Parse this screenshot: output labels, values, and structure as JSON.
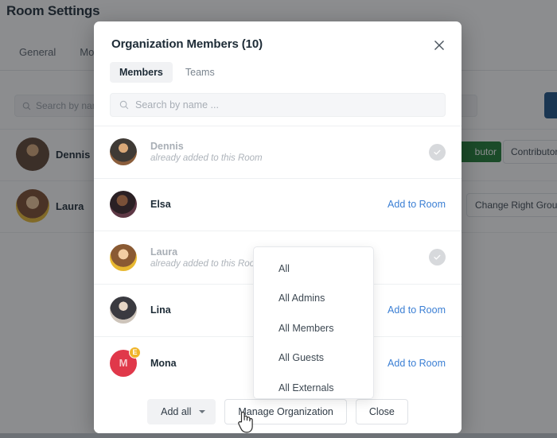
{
  "background": {
    "page_title": "Room Settings",
    "tabs": [
      "General",
      "Mod"
    ],
    "search_placeholder": "Search by name ...",
    "search_icon": "search-icon",
    "rows": [
      {
        "name": "Dennis"
      },
      {
        "name": "Laura"
      }
    ],
    "green_pill_label": "butor",
    "outline_pill_label": "Contributor",
    "change_right_group_label": "Change Right Group"
  },
  "modal": {
    "title": "Organization Members (10)",
    "close_icon": "close-icon",
    "tabs": [
      {
        "label": "Members",
        "active": true
      },
      {
        "label": "Teams",
        "active": false
      }
    ],
    "search": {
      "placeholder": "Search by name ...",
      "value": "",
      "icon": "search-icon"
    },
    "members": [
      {
        "name": "Dennis",
        "subtitle": "already added to this Room",
        "state": "added",
        "action_label": "",
        "avatar_type": "photo",
        "avatar_color": "#8a6a4a",
        "badge": null
      },
      {
        "name": "Elsa",
        "subtitle": "",
        "state": "addable",
        "action_label": "Add to Room",
        "avatar_type": "photo",
        "avatar_color": "#6b4b52",
        "badge": null
      },
      {
        "name": "Laura",
        "subtitle": "already added to this Room",
        "state": "added",
        "action_label": "",
        "avatar_type": "photo",
        "avatar_color": "#c08a3e",
        "badge": null
      },
      {
        "name": "Lina",
        "subtitle": "",
        "state": "addable",
        "action_label": "Add to Room",
        "avatar_type": "photo",
        "avatar_color": "#cfc6bd",
        "badge": null
      },
      {
        "name": "Mona",
        "subtitle": "",
        "state": "addable",
        "action_label": "Add to Room",
        "avatar_type": "initial",
        "avatar_initial": "M",
        "avatar_color": "#e0384a",
        "badge": "E"
      }
    ],
    "footer": {
      "add_all_label": "Add all",
      "manage_org_label": "Manage Organization",
      "close_label": "Close"
    },
    "dropdown": {
      "open": true,
      "items": [
        "All",
        "All Admins",
        "All Members",
        "All Guests",
        "All Externals"
      ]
    }
  },
  "colors": {
    "link": "#3b7fd4",
    "accent_blue": "#1b5185",
    "green": "#1d7a33",
    "badge_yellow": "#f0b429",
    "avatar_red": "#e0384a",
    "overlay": "rgba(25,28,32,0.50)"
  }
}
